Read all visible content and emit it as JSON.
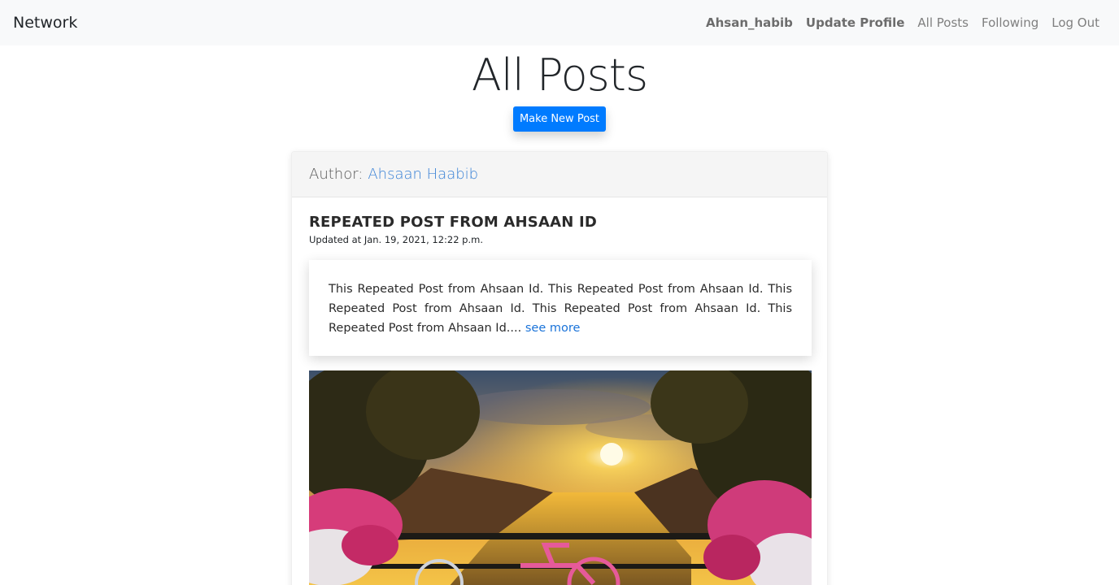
{
  "navbar": {
    "brand": "Network",
    "links": [
      {
        "label": "Ahsan_habib"
      },
      {
        "label": "Update Profile"
      },
      {
        "label": "All Posts"
      },
      {
        "label": "Following"
      },
      {
        "label": "Log Out"
      }
    ]
  },
  "page": {
    "title": "All Posts",
    "new_post_button": "Make New Post"
  },
  "post": {
    "author_label": "Author:",
    "author_name": "Ahsaan Haabib",
    "title": "REPEATED POST FROM AHSAAN ID",
    "updated": "Updated at Jan. 19, 2021, 12:22 p.m.",
    "body": "This Repeated Post from Ahsaan Id. This Repeated Post from Ahsaan Id. This Repeated Post from Ahsaan Id. This Repeated Post from Ahsaan Id. This Repeated Post from Ahsaan Id....",
    "see_more": "see more"
  },
  "colors": {
    "accent": "#007bff",
    "link": "#3a82d6",
    "navbar_bg": "#f8f9fa"
  }
}
